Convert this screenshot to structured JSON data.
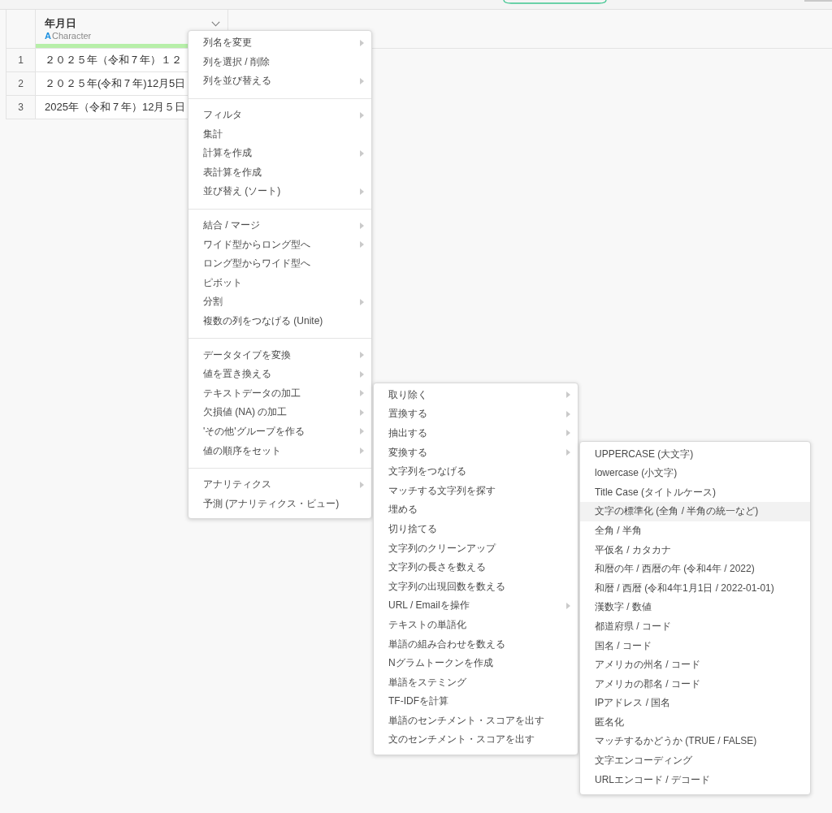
{
  "table": {
    "columns": [
      {
        "name": "年月日",
        "type_icon": "A",
        "type": "Character"
      }
    ],
    "rows": [
      {
        "number": "1",
        "cells": [
          "２０２５年（令和７年）１２"
        ]
      },
      {
        "number": "2",
        "cells": [
          "２０２５年(令和７年)12月5日"
        ]
      },
      {
        "number": "3",
        "cells": [
          "2025年（令和７年）12月５日"
        ]
      }
    ]
  },
  "menu": {
    "groups": [
      {
        "items": [
          {
            "label": "列名を変更",
            "arrow": true
          },
          {
            "label": "列を選択 / 削除",
            "arrow": false
          },
          {
            "label": "列を並び替える",
            "arrow": true
          }
        ]
      },
      {
        "items": [
          {
            "label": "フィルタ",
            "arrow": true
          },
          {
            "label": "集計",
            "arrow": false
          },
          {
            "label": "計算を作成",
            "arrow": true
          },
          {
            "label": "表計算を作成",
            "arrow": false
          },
          {
            "label": "並び替え (ソート)",
            "arrow": true
          }
        ]
      },
      {
        "items": [
          {
            "label": "結合 / マージ",
            "arrow": true
          },
          {
            "label": "ワイド型からロング型へ",
            "arrow": true
          },
          {
            "label": "ロング型からワイド型へ",
            "arrow": false
          },
          {
            "label": "ピボット",
            "arrow": false
          },
          {
            "label": "分割",
            "arrow": true
          },
          {
            "label": "複数の列をつなげる (Unite)",
            "arrow": false
          }
        ]
      },
      {
        "items": [
          {
            "label": "データタイプを変換",
            "arrow": true
          },
          {
            "label": "値を置き換える",
            "arrow": true
          },
          {
            "label": "テキストデータの加工",
            "arrow": true,
            "submenu": {
              "items": [
                {
                  "label": "取り除く",
                  "arrow": true
                },
                {
                  "label": "置換する",
                  "arrow": true
                },
                {
                  "label": "抽出する",
                  "arrow": true
                },
                {
                  "label": "変換する",
                  "arrow": true,
                  "submenu": {
                    "items": [
                      {
                        "label": "UPPERCASE (大文字)",
                        "selected": false
                      },
                      {
                        "label": "lowercase (小文字)",
                        "selected": false
                      },
                      {
                        "label": "Title Case (タイトルケース)",
                        "selected": false
                      },
                      {
                        "label": "文字の標準化 (全角 / 半角の統一など)",
                        "selected": true
                      },
                      {
                        "label": "全角 / 半角",
                        "selected": false
                      },
                      {
                        "label": "平仮名 / カタカナ",
                        "selected": false
                      },
                      {
                        "label": "和暦の年 / 西暦の年 (令和4年 / 2022)",
                        "selected": false
                      },
                      {
                        "label": "和暦 / 西暦 (令和4年1月1日 / 2022-01-01)",
                        "selected": false
                      },
                      {
                        "label": "漢数字 / 数値",
                        "selected": false
                      },
                      {
                        "label": "都道府県 / コード",
                        "selected": false
                      },
                      {
                        "label": "国名 / コード",
                        "selected": false
                      },
                      {
                        "label": "アメリカの州名 / コード",
                        "selected": false
                      },
                      {
                        "label": "アメリカの郡名 / コード",
                        "selected": false
                      },
                      {
                        "label": "IPアドレス / 国名",
                        "selected": false
                      },
                      {
                        "label": "匿名化",
                        "selected": false
                      },
                      {
                        "label": "マッチするかどうか (TRUE / FALSE)",
                        "selected": false
                      },
                      {
                        "label": "文字エンコーディング",
                        "selected": false
                      },
                      {
                        "label": "URLエンコード / デコード",
                        "selected": false
                      }
                    ]
                  }
                },
                {
                  "label": "文字列をつなげる",
                  "arrow": false
                },
                {
                  "label": "マッチする文字列を探す",
                  "arrow": false
                },
                {
                  "label": "埋める",
                  "arrow": false
                },
                {
                  "label": "切り捨てる",
                  "arrow": false
                },
                {
                  "label": "文字列のクリーンアップ",
                  "arrow": false
                },
                {
                  "label": "文字列の長さを数える",
                  "arrow": false
                },
                {
                  "label": "文字列の出現回数を数える",
                  "arrow": false
                },
                {
                  "label": "URL / Emailを操作",
                  "arrow": true
                },
                {
                  "label": "テキストの単語化",
                  "arrow": false
                },
                {
                  "label": "単語の組み合わせを数える",
                  "arrow": false
                },
                {
                  "label": "Nグラムトークンを作成",
                  "arrow": false
                },
                {
                  "label": "単語をステミング",
                  "arrow": false
                },
                {
                  "label": "TF-IDFを計算",
                  "arrow": false
                },
                {
                  "label": "単語のセンチメント・スコアを出す",
                  "arrow": false
                },
                {
                  "label": "文のセンチメント・スコアを出す",
                  "arrow": false
                }
              ]
            }
          },
          {
            "label": "欠損値 (NA) の加工",
            "arrow": true
          },
          {
            "label": "'その他'グループを作る",
            "arrow": true
          },
          {
            "label": "値の順序をセット",
            "arrow": true
          }
        ]
      },
      {
        "items": [
          {
            "label": "アナリティクス",
            "arrow": true
          },
          {
            "label": "予測 (アナリティクス・ビュー)",
            "arrow": false
          }
        ]
      }
    ]
  }
}
